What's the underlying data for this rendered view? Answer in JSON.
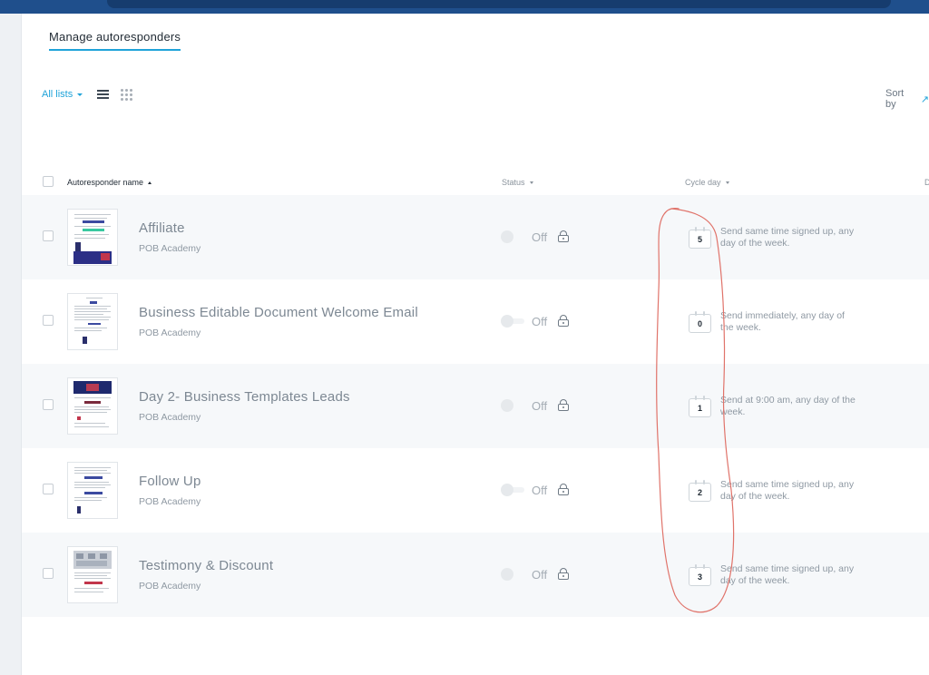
{
  "tabs": {
    "active": "Manage autoresponders"
  },
  "toolbar": {
    "all_lists_label": "All lists",
    "sort_by_label": "Sort by"
  },
  "table": {
    "headers": {
      "name": "Autoresponder name",
      "status": "Status",
      "cycle_day": "Cycle day",
      "more": "D"
    }
  },
  "rows": [
    {
      "name": "Affiliate",
      "list": "POB Academy",
      "status": "Off",
      "cycle_day": "5",
      "schedule": "Send same time signed up, any day of the week."
    },
    {
      "name": "Business Editable Document Welcome Email",
      "list": "POB Academy",
      "status": "Off",
      "cycle_day": "0",
      "schedule": "Send immediately, any day of the week."
    },
    {
      "name": "Day 2- Business Templates Leads",
      "list": "POB Academy",
      "status": "Off",
      "cycle_day": "1",
      "schedule": "Send at 9:00 am, any day of the week."
    },
    {
      "name": "Follow Up",
      "list": "POB Academy",
      "status": "Off",
      "cycle_day": "2",
      "schedule": "Send same time signed up, any day of the week."
    },
    {
      "name": "Testimony & Discount",
      "list": "POB Academy",
      "status": "Off",
      "cycle_day": "3",
      "schedule": "Send same time signed up, any day of the week."
    }
  ],
  "colors": {
    "accent": "#1fa3d9",
    "topbar": "#1f4f8c",
    "annotation": "#e0736a",
    "row_shade": "#f6f8fa"
  },
  "icons": [
    "caret-down-icon",
    "list-view-icon",
    "grid-view-icon",
    "sort-arrow-icon",
    "lock-icon",
    "calendar-icon"
  ]
}
